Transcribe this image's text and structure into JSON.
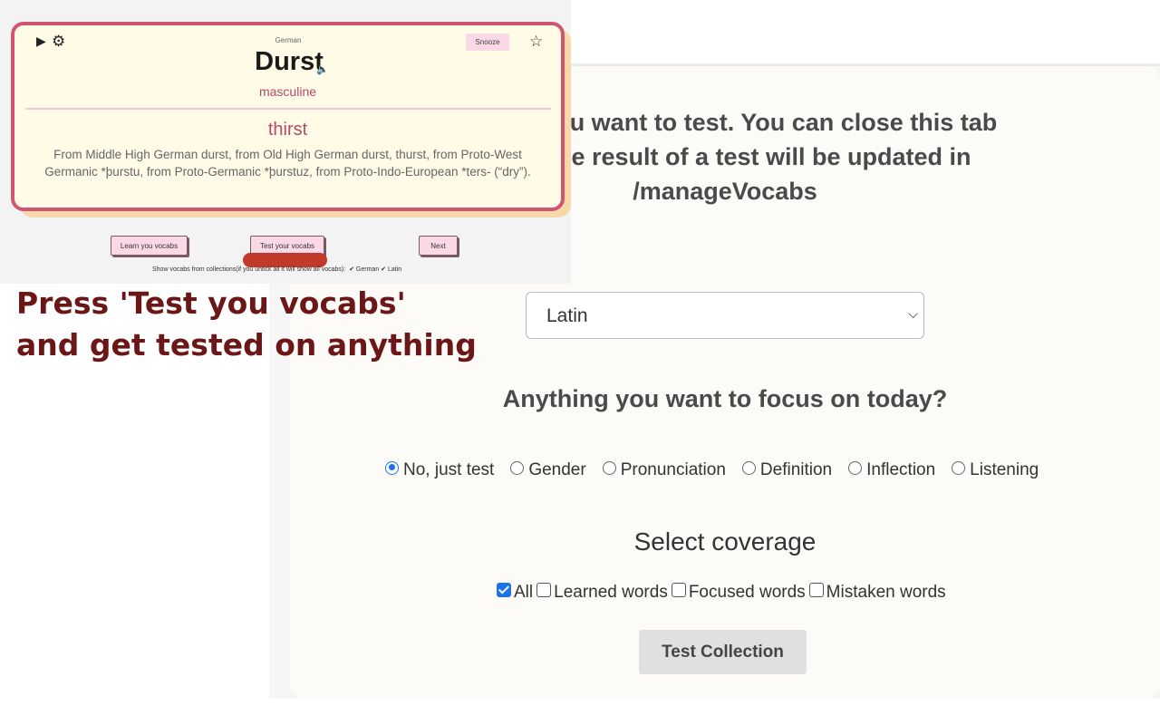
{
  "test_page": {
    "intro_lines": [
      "on that you want to test. You can close this tab",
      "want, the result of a test will be updated in",
      "/manageVocabs"
    ],
    "collection_select": {
      "value": "Latin"
    },
    "focus_question": "Anything you want to focus on today?",
    "focus_options": [
      {
        "label": "No, just test",
        "selected": true
      },
      {
        "label": "Gender",
        "selected": false
      },
      {
        "label": "Pronunciation",
        "selected": false
      },
      {
        "label": "Definition",
        "selected": false
      },
      {
        "label": "Inflection",
        "selected": false
      },
      {
        "label": "Listening",
        "selected": false
      }
    ],
    "coverage_title": "Select coverage",
    "coverage_options": [
      {
        "label": "All",
        "checked": true
      },
      {
        "label": "Learned words",
        "checked": false
      },
      {
        "label": "Focused words",
        "checked": false
      },
      {
        "label": "Mistaken words",
        "checked": false
      }
    ],
    "submit_label": "Test Collection"
  },
  "overlay": {
    "card": {
      "language": "German",
      "snooze_label": "Snooze",
      "word": "Durst",
      "gender": "masculine",
      "meaning": "thirst",
      "etymology_lines": [
        "From Middle High German durst, from Old High German durst, thurst, from Proto-West",
        "Germanic *þurstu, from Proto-Germanic *þurstuz, from Proto-Indo-European *ters- (“dry”)."
      ]
    },
    "buttons": {
      "learn": "Learn you vocabs",
      "test": "Test your vocabs",
      "next": "Next"
    },
    "show_collections": {
      "label": "Show vocabs from collections(if you untick all it will show all vocabs):",
      "options": [
        "German",
        "Latin"
      ]
    },
    "headline_lines": [
      "Press 'Test you vocabs'",
      "and get tested on anything"
    ]
  },
  "colors": {
    "card_border": "#cf5573",
    "card_bg": "#fffbe6",
    "accent_text": "#b34a6a",
    "headline": "#6b1717",
    "radio_checked": "#1a73e8",
    "red_mark": "#c13a2c"
  }
}
